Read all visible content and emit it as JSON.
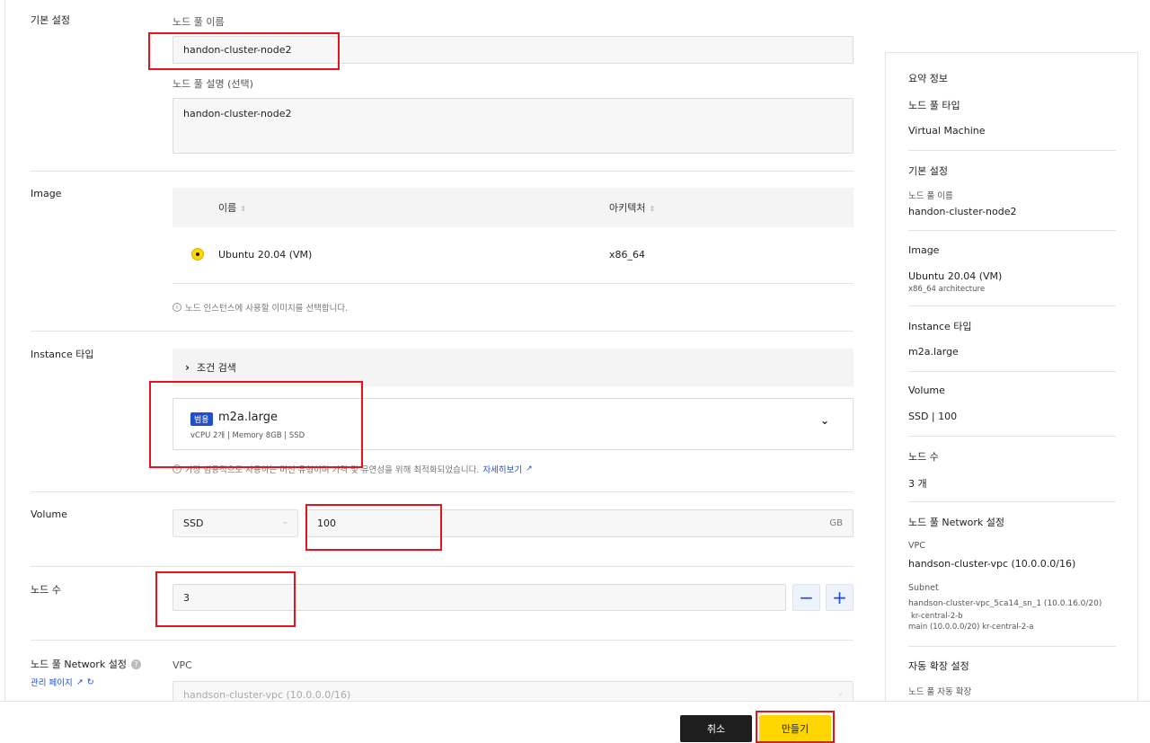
{
  "form": {
    "basic": {
      "section_label": "기본 설정",
      "name_label": "노드 풀 이름",
      "name_value": "handon-cluster-node2",
      "desc_label": "노드 풀 설명 (선택)",
      "desc_value": "handon-cluster-node2"
    },
    "image": {
      "section_label": "Image",
      "columns": [
        "이름",
        "아키텍처"
      ],
      "row": {
        "name": "Ubuntu 20.04 (VM)",
        "arch": "x86_64"
      },
      "hint": "노드 인스턴스에 사용할 이미지를 선택합니다."
    },
    "instance": {
      "section_label": "Instance 타입",
      "filter_label": "조건 검색",
      "badge": "범용",
      "type_name": "m2a.large",
      "spec": "vCPU 2개 | Memory 8GB | SSD",
      "hint_text": "가장 범용적으로 사용하는 머신 유형이며 가격 및 유연성을 위해 최적화되었습니다.",
      "hint_link": "자세히보기"
    },
    "volume": {
      "section_label": "Volume",
      "type": "SSD",
      "size": "100",
      "unit": "GB"
    },
    "nodes": {
      "section_label": "노드 수",
      "value": "3",
      "minus": "−",
      "plus": "+"
    },
    "network": {
      "section_label": "노드 풀 Network 설정",
      "help": "?",
      "manage_link": "관리 페이지",
      "vpc_label": "VPC",
      "vpc_value": "handson-cluster-vpc (10.0.0.0/16)"
    }
  },
  "summary": {
    "title": "요약 정보",
    "node_type_label": "노드 풀 타입",
    "node_type_value": "Virtual Machine",
    "basic_label": "기본 설정",
    "name_label": "노드 풀 이름",
    "name_value": "handon-cluster-node2",
    "image_label": "Image",
    "image_value": "Ubuntu 20.04 (VM)",
    "image_arch": "x86_64 architecture",
    "instance_label": "Instance 타입",
    "instance_value": "m2a.large",
    "volume_label": "Volume",
    "volume_value": "SSD | 100",
    "nodes_label": "노드 수",
    "nodes_value": "3 개",
    "network_label": "노드 풀 Network 설정",
    "vpc_label": "VPC",
    "vpc_value": "handson-cluster-vpc (10.0.0.0/16)",
    "subnet_label": "Subnet",
    "subnet_line1": "handson-cluster-vpc_5ca14_sn_1 (10.0.16.0/20)",
    "subnet_line2": "kr-central-2-b",
    "subnet_line3": "main (10.0.0.0/20) kr-central-2-a",
    "autoscale_label": "자동 확장 설정",
    "autoscale_sub": "노드 풀 자동 확장"
  },
  "footer": {
    "cancel": "취소",
    "create": "만들기"
  },
  "colors": {
    "accent_blue": "#1f4fcc",
    "primary_yellow": "#ffd600",
    "annotation_red": "#e5141a"
  }
}
